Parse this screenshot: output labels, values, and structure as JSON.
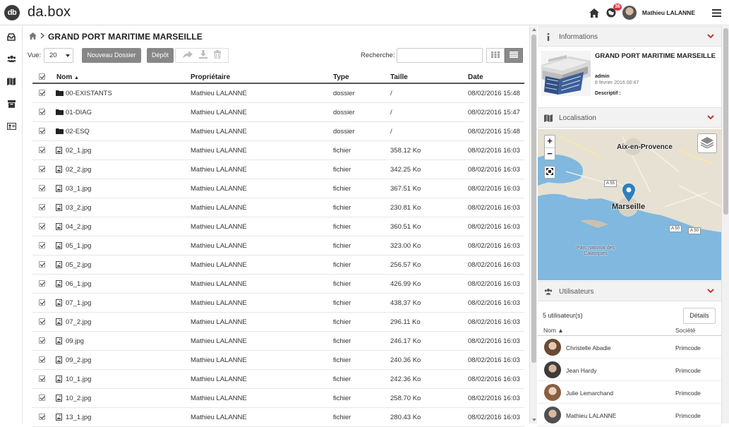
{
  "app": {
    "logo_badge": "db",
    "logo_text": "da.box"
  },
  "topbar": {
    "notifications": "36",
    "user_name": "Mathieu LALANNE"
  },
  "breadcrumb": {
    "title": "GRAND PORT MARITIME MARSEILLE"
  },
  "toolbar": {
    "view_label": "Vue:",
    "view_value": "20",
    "new_folder_label": "Nouveau Dossier",
    "upload_label": "Dépôt",
    "search_label": "Recherche:",
    "search_value": ""
  },
  "table": {
    "columns": [
      "Nom",
      "Propriétaire",
      "Type",
      "Taille",
      "Date"
    ],
    "sort_indicator": "▲",
    "rows": [
      {
        "name": "00-EXISTANTS",
        "owner": "Mathieu LALANNE",
        "type": "dossier",
        "size": "/",
        "date": "08/02/2016 15:48",
        "icon": "folder-icon"
      },
      {
        "name": "01-DIAG",
        "owner": "Mathieu LALANNE",
        "type": "dossier",
        "size": "/",
        "date": "08/02/2016 15:47",
        "icon": "folder-icon"
      },
      {
        "name": "02-ESQ",
        "owner": "Mathieu LALANNE",
        "type": "dossier",
        "size": "/",
        "date": "08/02/2016 15:48",
        "icon": "folder-icon"
      },
      {
        "name": "02_1.jpg",
        "owner": "Mathieu LALANNE",
        "type": "fichier",
        "size": "358.12 Ko",
        "date": "08/02/2016 16:03",
        "icon": "image-file-icon"
      },
      {
        "name": "02_2.jpg",
        "owner": "Mathieu LALANNE",
        "type": "fichier",
        "size": "342.25 Ko",
        "date": "08/02/2016 16:03",
        "icon": "image-file-icon"
      },
      {
        "name": "03_1.jpg",
        "owner": "Mathieu LALANNE",
        "type": "fichier",
        "size": "367.51 Ko",
        "date": "08/02/2016 16:03",
        "icon": "image-file-icon"
      },
      {
        "name": "03_2.jpg",
        "owner": "Mathieu LALANNE",
        "type": "fichier",
        "size": "230.81 Ko",
        "date": "08/02/2016 16:03",
        "icon": "image-file-icon"
      },
      {
        "name": "04_2.jpg",
        "owner": "Mathieu LALANNE",
        "type": "fichier",
        "size": "360.51 Ko",
        "date": "08/02/2016 16:03",
        "icon": "image-file-icon"
      },
      {
        "name": "05_1.jpg",
        "owner": "Mathieu LALANNE",
        "type": "fichier",
        "size": "323.00 Ko",
        "date": "08/02/2016 16:03",
        "icon": "image-file-icon"
      },
      {
        "name": "05_2.jpg",
        "owner": "Mathieu LALANNE",
        "type": "fichier",
        "size": "256.57 Ko",
        "date": "08/02/2016 16:03",
        "icon": "image-file-icon"
      },
      {
        "name": "06_1.jpg",
        "owner": "Mathieu LALANNE",
        "type": "fichier",
        "size": "426.99 Ko",
        "date": "08/02/2016 16:03",
        "icon": "image-file-icon"
      },
      {
        "name": "07_1.jpg",
        "owner": "Mathieu LALANNE",
        "type": "fichier",
        "size": "438.37 Ko",
        "date": "08/02/2016 16:03",
        "icon": "image-file-icon"
      },
      {
        "name": "07_2.jpg",
        "owner": "Mathieu LALANNE",
        "type": "fichier",
        "size": "296.11 Ko",
        "date": "08/02/2016 16:03",
        "icon": "image-file-icon"
      },
      {
        "name": "09.jpg",
        "owner": "Mathieu LALANNE",
        "type": "fichier",
        "size": "246.17 Ko",
        "date": "08/02/2016 16:03",
        "icon": "image-file-icon"
      },
      {
        "name": "09_2.jpg",
        "owner": "Mathieu LALANNE",
        "type": "fichier",
        "size": "240.36 Ko",
        "date": "08/02/2016 16:03",
        "icon": "image-file-icon"
      },
      {
        "name": "10_1.jpg",
        "owner": "Mathieu LALANNE",
        "type": "fichier",
        "size": "242.36 Ko",
        "date": "08/02/2016 16:03",
        "icon": "image-file-icon"
      },
      {
        "name": "10_2.jpg",
        "owner": "Mathieu LALANNE",
        "type": "fichier",
        "size": "258.70 Ko",
        "date": "08/02/2016 16:03",
        "icon": "image-file-icon"
      },
      {
        "name": "13_1.jpg",
        "owner": "Mathieu LALANNE",
        "type": "fichier",
        "size": "280.43 Ko",
        "date": "08/02/2016 16:03",
        "icon": "image-file-icon"
      }
    ]
  },
  "panel": {
    "info": {
      "header": "Informations",
      "title": "GRAND PORT MARITIME MARSEILLE",
      "author": "admin",
      "date": "8 février 2016 00:47",
      "description_label": "Descriptif :"
    },
    "location": {
      "header": "Localisation",
      "map_labels": {
        "city": "Marseille",
        "town": "Aix-en-Provence",
        "park": "Parc national des Calanques",
        "road_a55": "A 55",
        "road_a50a": "A 50",
        "road_a50b": "A 50"
      },
      "zoom_in": "+",
      "zoom_out": "−"
    },
    "users": {
      "header": "Utilisateurs",
      "count": "5 utilisateur(s)",
      "details_label": "Détails",
      "col_name": "Nom ▲",
      "col_company": "Société",
      "list": [
        {
          "name": "Christelle Abadie",
          "company": "Primcode"
        },
        {
          "name": "Jean Hardy",
          "company": "Primcode"
        },
        {
          "name": "Julie Lemarchand",
          "company": "Primcode"
        },
        {
          "name": "Mathieu LALANNE",
          "company": "Primcode"
        }
      ]
    }
  },
  "colors": {
    "accent": "#c0392b",
    "button_grey": "#878787",
    "header_bg": "#f2f2f2",
    "map_water": "#7fb6dd",
    "marker": "#2a7fc1"
  }
}
